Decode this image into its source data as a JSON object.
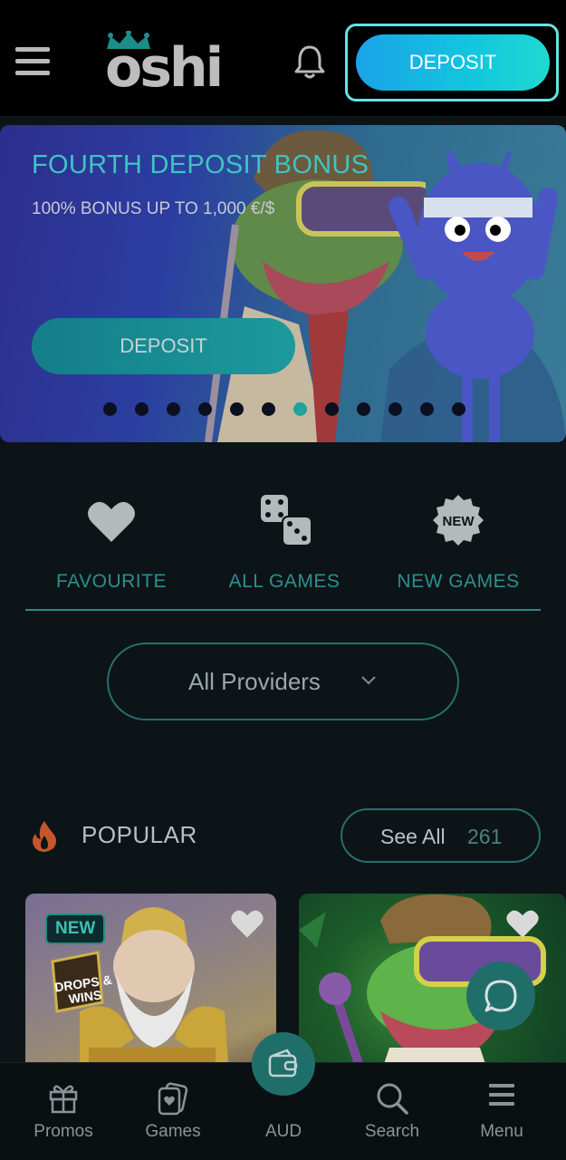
{
  "header": {
    "logo_text": "oshi",
    "deposit_label": "DEPOSIT"
  },
  "banner": {
    "title": "FOURTH DEPOSIT BONUS",
    "subtitle": "100% BONUS UP TO 1,000 €/$",
    "button_label": "DEPOSIT",
    "slide_count": 12,
    "active_slide": 7
  },
  "categories": [
    {
      "label": "FAVOURITE",
      "icon": "heart-icon"
    },
    {
      "label": "ALL GAMES",
      "icon": "dice-icon"
    },
    {
      "label": "NEW GAMES",
      "icon": "new-badge-icon"
    }
  ],
  "providers": {
    "label": "All Providers"
  },
  "popular": {
    "title": "POPULAR",
    "see_all_label": "See All",
    "see_all_count": "261"
  },
  "games": [
    {
      "badge": "NEW",
      "art_text": "DROPS & WINS"
    },
    {}
  ],
  "bottom_nav": [
    {
      "label": "Promos",
      "icon": "gift-icon"
    },
    {
      "label": "Games",
      "icon": "cards-icon"
    },
    {
      "label": "AUD",
      "icon": "wallet-icon"
    },
    {
      "label": "Search",
      "icon": "search-icon"
    },
    {
      "label": "Menu",
      "icon": "menu-icon"
    }
  ],
  "colors": {
    "accent": "#1fa39a",
    "deposit_gradient_start": "#1aa3e8",
    "deposit_gradient_end": "#1fd9d0",
    "background": "#0c1418"
  }
}
